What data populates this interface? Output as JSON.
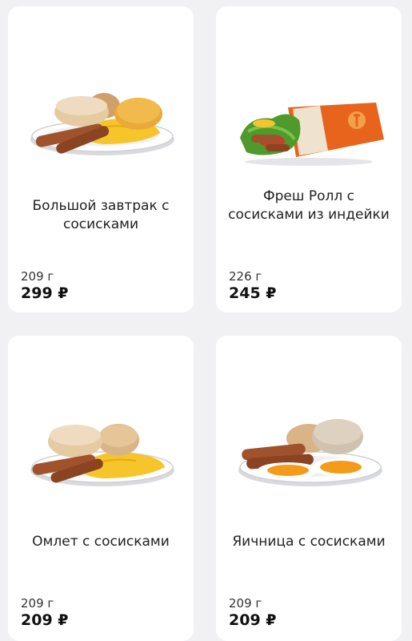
{
  "products": [
    {
      "title": "Большой завтрак с сосисками",
      "weight": "209 г",
      "price": "299 ₽",
      "image_icon": "big-breakfast-plate-icon"
    },
    {
      "title": "Фреш Ролл с сосисками из индейки",
      "weight": "226 г",
      "price": "245 ₽",
      "image_icon": "wrap-roll-icon"
    },
    {
      "title": "Омлет с сосисками",
      "weight": "209 г",
      "price": "209 ₽",
      "image_icon": "omelet-plate-icon"
    },
    {
      "title": "Яичница с сосисками",
      "weight": "209 г",
      "price": "209 ₽",
      "image_icon": "fried-eggs-plate-icon"
    }
  ],
  "colors": {
    "background": "#f1f1f3",
    "card": "#ffffff",
    "wrap_orange": "#e8641c",
    "egg_yellow": "#f6c52b",
    "sausage": "#a0522d"
  }
}
